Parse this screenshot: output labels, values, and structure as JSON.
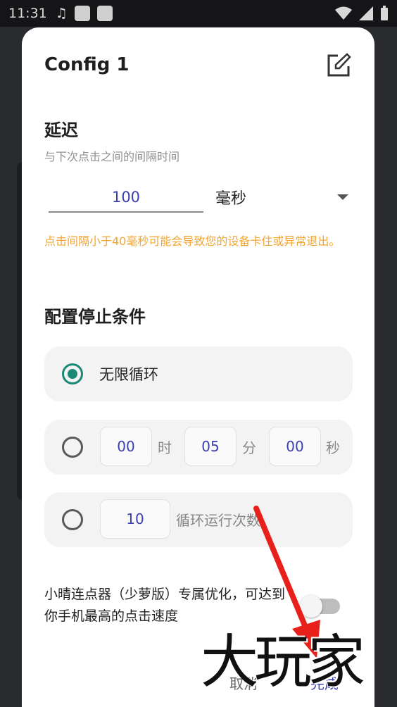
{
  "status_bar": {
    "time": "11:31"
  },
  "dialog": {
    "title": "Config 1",
    "delay": {
      "title": "延迟",
      "hint": "与下次点击之间的间隔时间",
      "value": "100",
      "unit": "毫秒",
      "warning": "点击间隔小于40毫秒可能会导致您的设备卡住或异常退出。"
    },
    "stop": {
      "title": "配置停止条件",
      "infinite_label": "无限循环",
      "timer": {
        "hours": "00",
        "hours_unit": "时",
        "minutes": "05",
        "minutes_unit": "分",
        "seconds": "00",
        "seconds_unit": "秒"
      },
      "count": {
        "value": "10",
        "unit": "循环运行次数"
      }
    },
    "optimization_text": "小晴连点器（少萝版）专属优化，可达到你手机最高的点击速度",
    "cancel_label": "取消",
    "done_label": "完成"
  },
  "watermark": "大玩家",
  "colors": {
    "accent": "#1a8a74",
    "value_text": "#3b3fb0",
    "warning": "#f2a531"
  }
}
